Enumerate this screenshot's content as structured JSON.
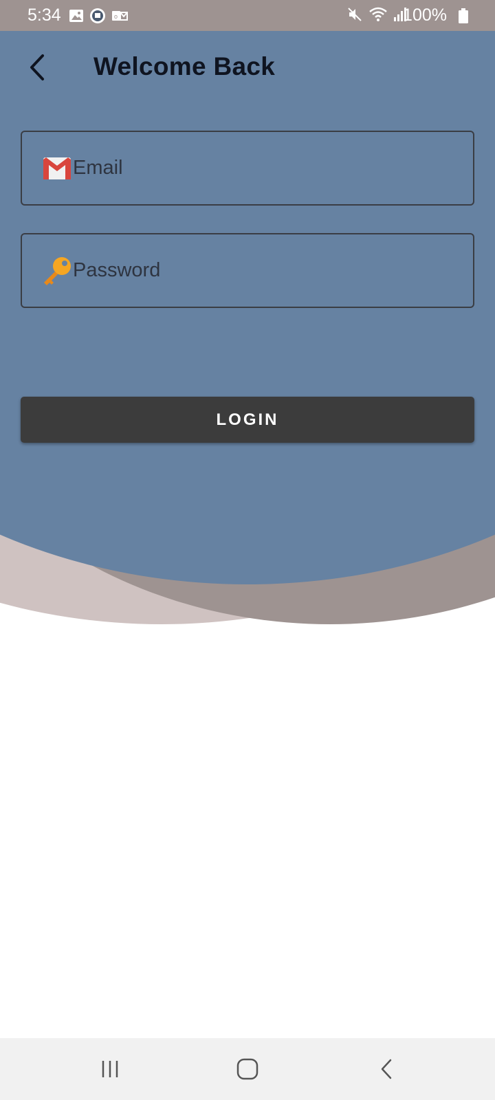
{
  "status_bar": {
    "time": "5:34",
    "battery": "100%"
  },
  "header": {
    "title": "Welcome Back",
    "back_icon": "chevron-left-icon"
  },
  "form": {
    "email": {
      "placeholder": "Email",
      "icon": "gmail-icon"
    },
    "password": {
      "placeholder": "Password",
      "icon": "key-icon"
    },
    "login_label": "LOGIN"
  },
  "colors": {
    "primary_bg": "#6682a2",
    "secondary_curve": "#9e9391",
    "tertiary_curve": "#cfc2c1",
    "button": "#3c3c3c",
    "status_bar": "#9e9391"
  },
  "nav_bar": {
    "recent_icon": "recent-apps-icon",
    "home_icon": "home-icon",
    "back_icon": "back-icon"
  }
}
